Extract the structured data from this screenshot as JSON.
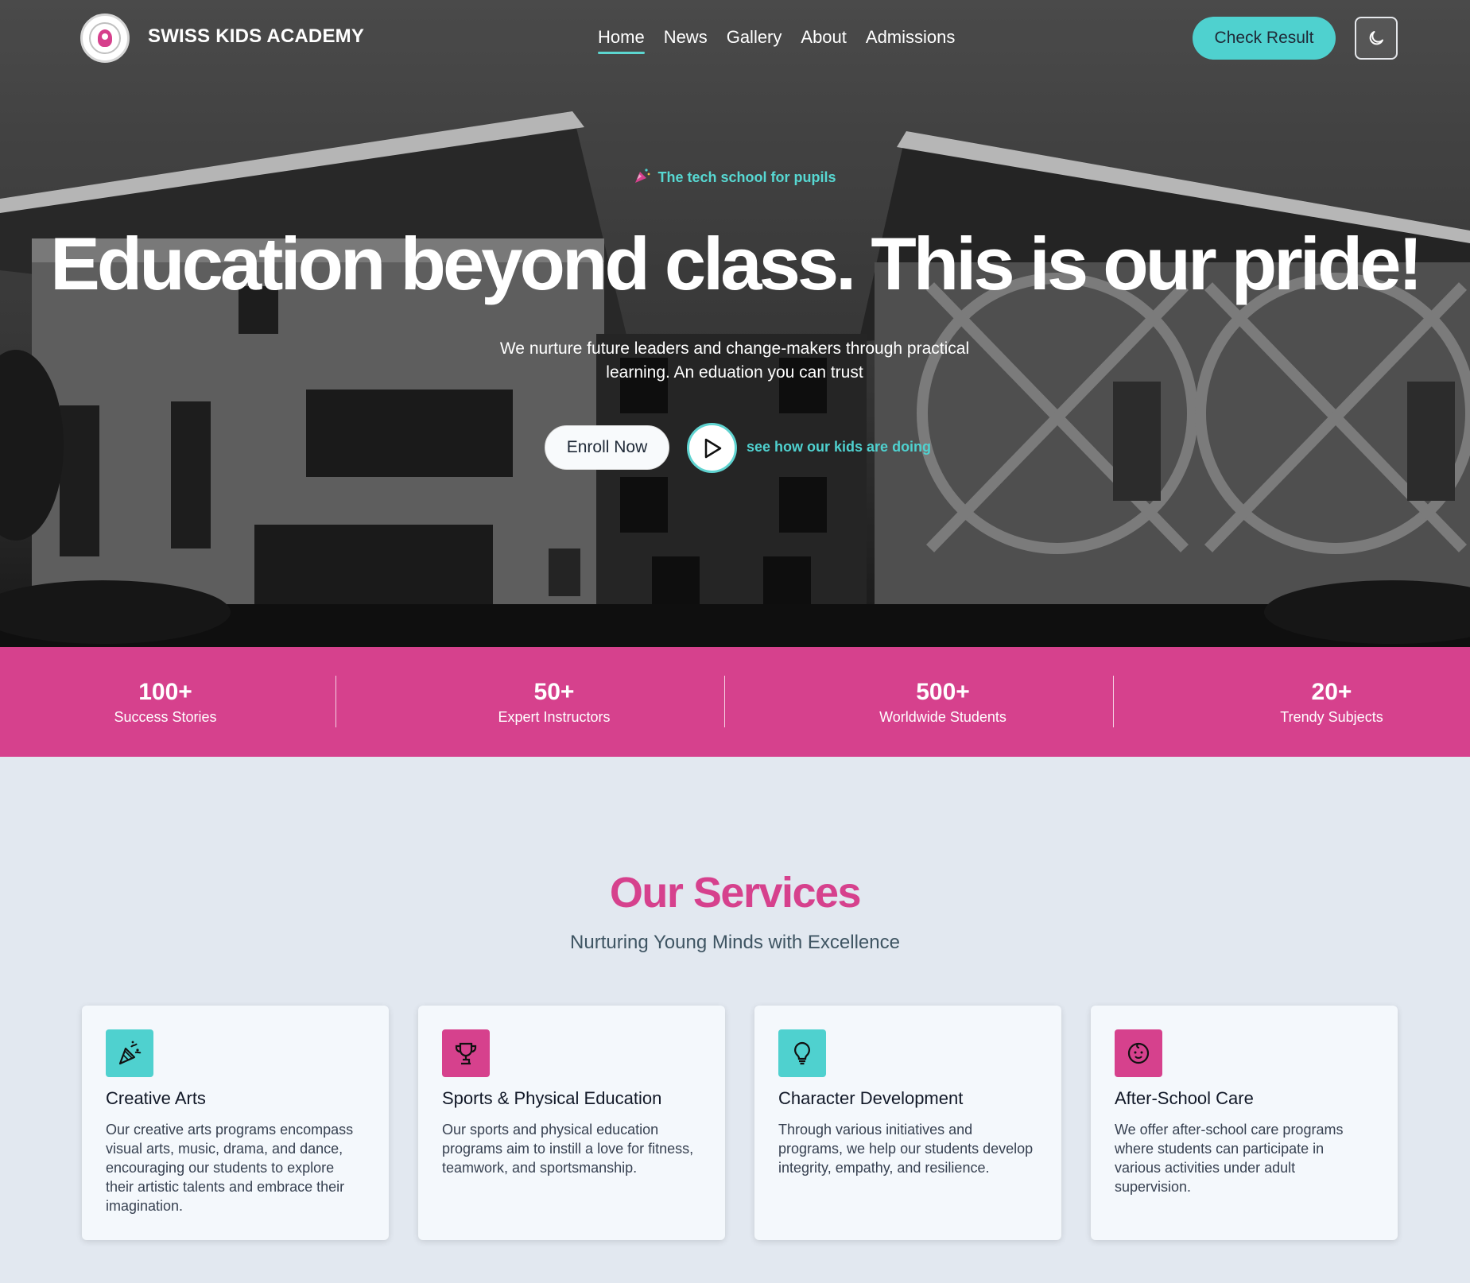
{
  "nav": {
    "brand": "SWISS KIDS ACADEMY",
    "menu": [
      "Home",
      "News",
      "Gallery",
      "About",
      "Admissions"
    ],
    "active": "Home",
    "check_result": "Check Result",
    "theme_icon": "moon-icon"
  },
  "hero": {
    "tagline": "The tech school for pupils",
    "headline": "Education beyond class. This is our pride!",
    "subtext": "We nurture future leaders and change-makers through practical learning. An eduation you can trust",
    "enroll_label": "Enroll Now",
    "video_label": "see how our kids are doing"
  },
  "stats": [
    {
      "num": "100+",
      "label": "Success Stories"
    },
    {
      "num": "50+",
      "label": "Expert Instructors"
    },
    {
      "num": "500+",
      "label": "Worldwide Students"
    },
    {
      "num": "20+",
      "label": "Trendy Subjects"
    }
  ],
  "services": {
    "title": "Our Services",
    "subtitle": "Nurturing Young Minds with Excellence",
    "cards": [
      {
        "icon": "party-popper-icon",
        "color": "#4fd1cf",
        "title": "Creative Arts",
        "text": "Our creative arts programs encompass visual arts, music, drama, and dance, encouraging our students to explore their artistic talents and embrace their imagination."
      },
      {
        "icon": "trophy-icon",
        "color": "#d6418d",
        "title": "Sports & Physical Education",
        "text": "Our sports and physical education programs aim to instill a love for fitness, teamwork, and sportsmanship."
      },
      {
        "icon": "lightbulb-icon",
        "color": "#4fd1cf",
        "title": "Character Development",
        "text": "Through various initiatives and programs, we help our students develop integrity, empathy, and resilience."
      },
      {
        "icon": "baby-face-icon",
        "color": "#d6418d",
        "title": "After-School Care",
        "text": "We offer after-school care programs where students can participate in various activities under adult supervision."
      }
    ]
  },
  "colors": {
    "accent_teal": "#4fd1cf",
    "accent_pink": "#d6418d",
    "page_bg": "#e2e8f0"
  }
}
